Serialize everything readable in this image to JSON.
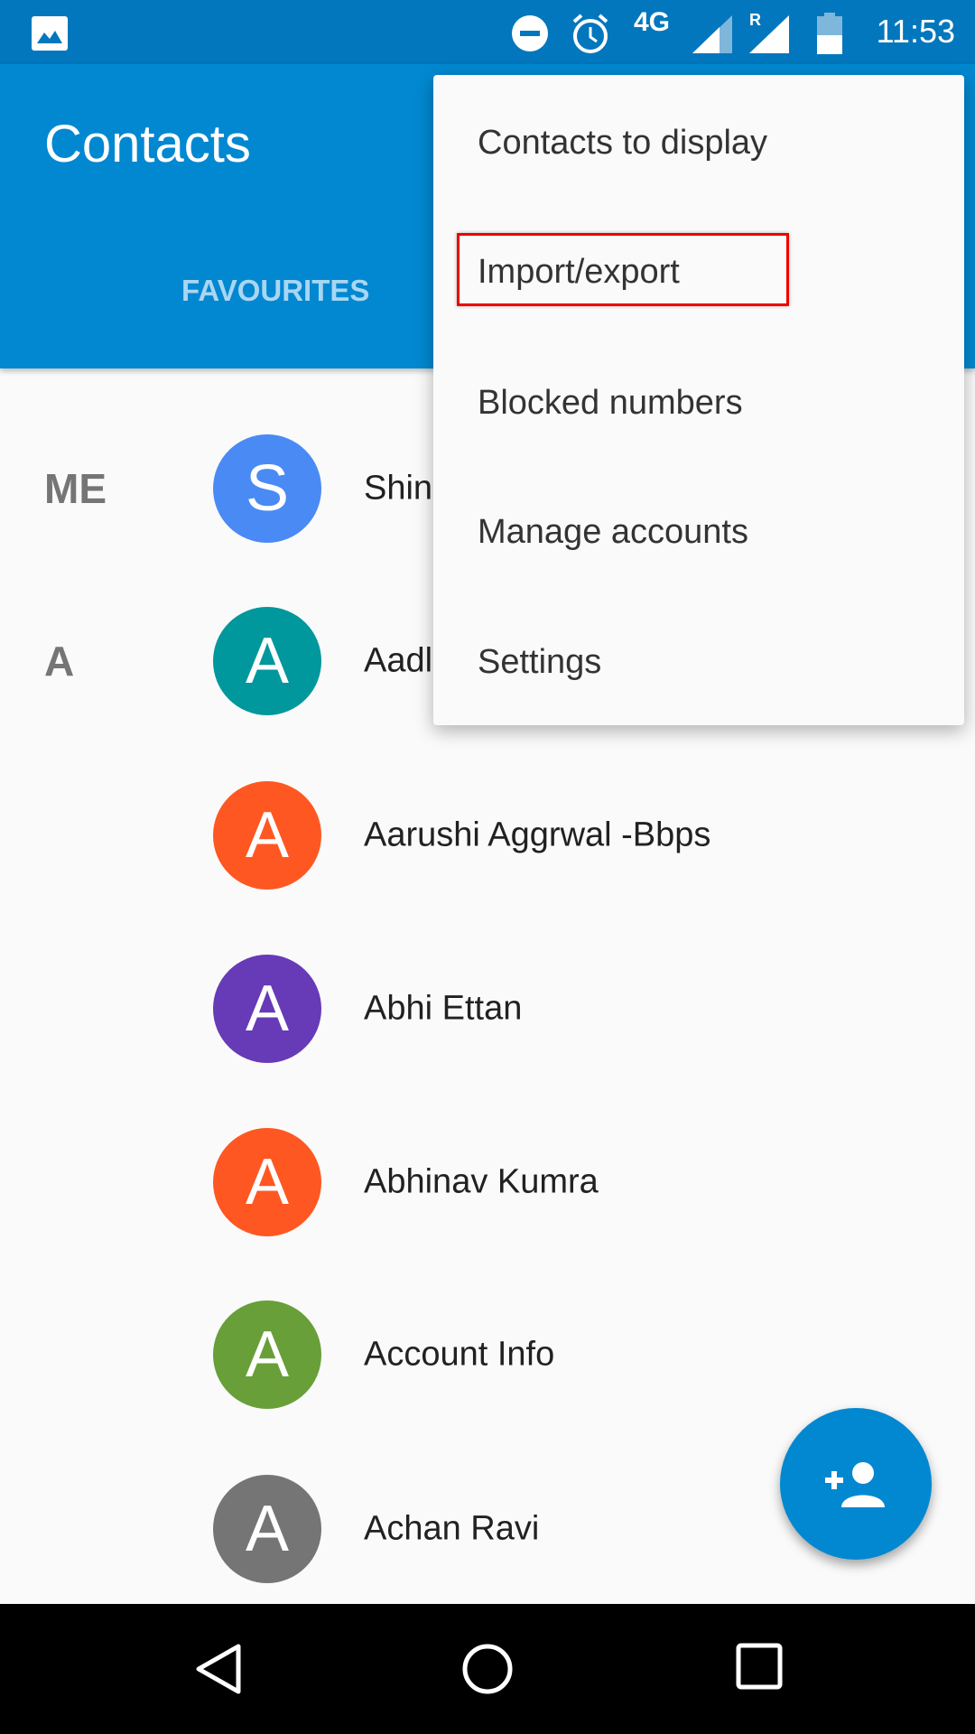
{
  "status_bar": {
    "time": "11:53",
    "network": "4G",
    "roaming": "R",
    "icons": [
      "image-icon",
      "dnd-icon",
      "alarm-icon",
      "signal-icon",
      "signal-roaming-icon",
      "battery-icon"
    ]
  },
  "app_bar": {
    "title": "Contacts",
    "tabs": [
      {
        "label": "FAVOURITES"
      }
    ]
  },
  "overflow_menu": {
    "items": [
      {
        "label": "Contacts to display"
      },
      {
        "label": "Import/export",
        "highlighted": true
      },
      {
        "label": "Blocked numbers"
      },
      {
        "label": "Manage accounts"
      },
      {
        "label": "Settings"
      }
    ],
    "highlight_color": "#e00000"
  },
  "contacts": [
    {
      "section": "ME",
      "initial": "S",
      "name": "Shin",
      "color": "#4a8af4"
    },
    {
      "section": "A",
      "initial": "A",
      "name": "Aadl",
      "color": "#00979d"
    },
    {
      "section": "",
      "initial": "A",
      "name": "Aarushi Aggrwal -Bbps",
      "color": "#ff5722"
    },
    {
      "section": "",
      "initial": "A",
      "name": "Abhi Ettan",
      "color": "#673ab7"
    },
    {
      "section": "",
      "initial": "A",
      "name": "Abhinav Kumra",
      "color": "#ff5722"
    },
    {
      "section": "",
      "initial": "A",
      "name": "Account Info",
      "color": "#689f38"
    },
    {
      "section": "",
      "initial": "A",
      "name": "Achan Ravi",
      "color": "#757575"
    }
  ],
  "fab": {
    "icon": "add-person-icon"
  },
  "nav_bar": {
    "icons": [
      "back-icon",
      "home-icon",
      "recents-icon"
    ]
  },
  "colors": {
    "status_bar": "#0277bd",
    "app_bar": "#0288d1",
    "fab": "#0288d1"
  }
}
